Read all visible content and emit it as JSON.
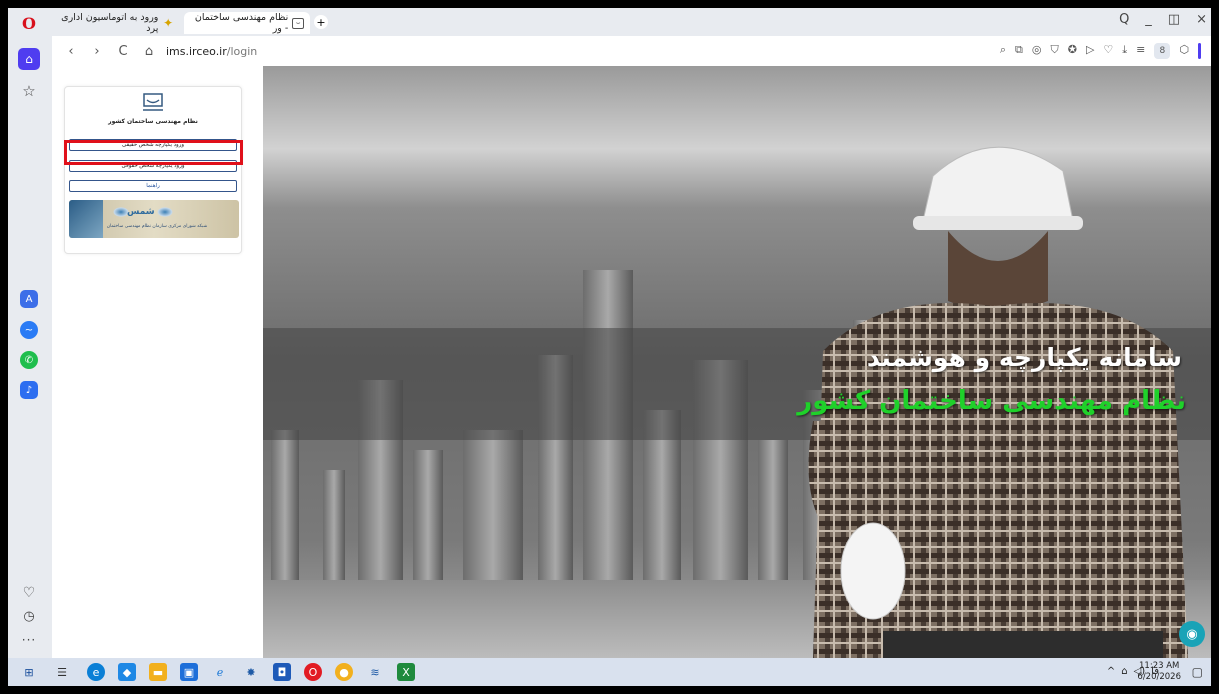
{
  "browser": {
    "tabs": [
      {
        "label": "ورود به اتوماسیون اداری پرد",
        "favicon": "star-icon"
      },
      {
        "label": "نظام مهندسی ساختمان - ور",
        "favicon": "handshake-icon"
      }
    ],
    "new_tab": "+",
    "window_controls": {
      "search": "Q",
      "minimize": "_",
      "restore": "◫",
      "close": "×"
    },
    "url_domain": "ims.irceo.ir",
    "url_path": "/login",
    "nav": {
      "back": "‹",
      "forward": "›",
      "reload": "C",
      "lock": "⌂"
    }
  },
  "sidebar": {
    "logo": "O",
    "home": "⌂",
    "bookmarks": "☆",
    "apps": [
      {
        "name": "aria",
        "glyph": "A"
      },
      {
        "name": "messenger",
        "glyph": "~"
      },
      {
        "name": "whatsapp",
        "glyph": "✆"
      },
      {
        "name": "player",
        "glyph": "♪"
      }
    ],
    "heart": "♡",
    "history": "◷",
    "more": "···"
  },
  "login": {
    "org_name": "نظام مهندسی ساختمان کشور",
    "btn_real_person": "ورود یکپارچه شخص حقیقی",
    "btn_legal_person": "ورود یکپارچه شخص حقوقی",
    "btn_guide": "راهنما",
    "shams_name": "شمس",
    "shams_desc": "شبکه شورای مرکزی سازمان نظام مهندسی ساختمان"
  },
  "hero": {
    "title": "سامانه یکپارچه و هوشمند",
    "subtitle": "نظام مهندسی ساختمان کشور",
    "title_color": "#ffffff",
    "subtitle_color": "#1fd12a"
  },
  "taskbar": {
    "tray_lang": "فا",
    "time": "11:23 AM",
    "date": "6/20/2026"
  }
}
